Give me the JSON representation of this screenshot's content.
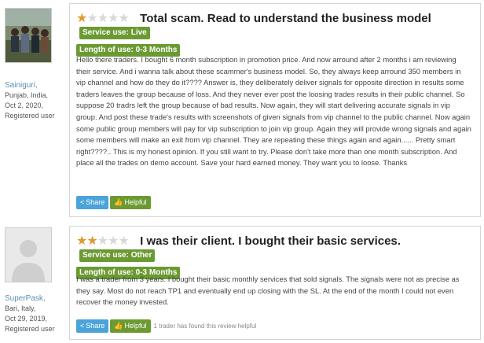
{
  "reviews": [
    {
      "user": {
        "name": "Sainiguri,",
        "location": "Punjab, India,",
        "date": "Oct 2, 2020,",
        "status": "Registered user"
      },
      "rating": {
        "value": 1,
        "max": 5
      },
      "title": "Total scam. Read to understand the business model",
      "service_use": "Service use: Live",
      "length_of_use": "Length of use: 0-3 Months",
      "body": "Hello there traders. I bought 6 month subscription in promotion price. And now arround after 2 months i am reviewing their service. And i wanna talk about these scammer's business model. So, they always keep arround 350 members in vip channel and how do they do it???? Answer is, they deliberately deliver signals for opposite direction in results some traders leaves the group because of loss. And they never ever post the loosing trades results in their public channel. So suppose 20 tradrs left the group because of bad results. Now again, they will start delivering accurate signals in vip group. And post these trade's results with screenshots of given signals from vip channel to the public channel. Now again some public group members will pay for vip subscription to join vip group. Again they will provide wrong signals and again some members will make an exit from vip channel. They are repeating these things again and again...... Pretty smart right????.. This is my honest opinion. If you still want to try. Please don't take more than one month subscription. And place all the trades on demo account. Save your hard earned money. They want you to loose. Thanks",
      "share_label": "Share",
      "helpful_label": "Helpful",
      "helpful_note": ""
    },
    {
      "user": {
        "name": "SuperPask,",
        "location": "Bari, Italy,",
        "date": "Oct 29, 2019,",
        "status": "Registered user"
      },
      "rating": {
        "value": 2,
        "max": 5
      },
      "title": "I was their client. I bought their basic services.",
      "service_use": "Service use: Other",
      "length_of_use": "Length of use: 0-3 Months",
      "body": "I was a trader from 3 years. I bought their basic monthly services that sold signals. The signals were not as precise as they say. Most do not reach TP1 and eventually end up closing with the SL. At the end of the month I could not even recover the money invested.",
      "share_label": "Share",
      "helpful_label": "Helpful",
      "helpful_note": "1 trader has found this review helpful"
    }
  ],
  "colors": {
    "star_on": "#e09a2d",
    "star_off": "#d8d8d8",
    "badge": "#6b9a33",
    "share": "#4aa3d9",
    "username": "#5a8fb0"
  }
}
